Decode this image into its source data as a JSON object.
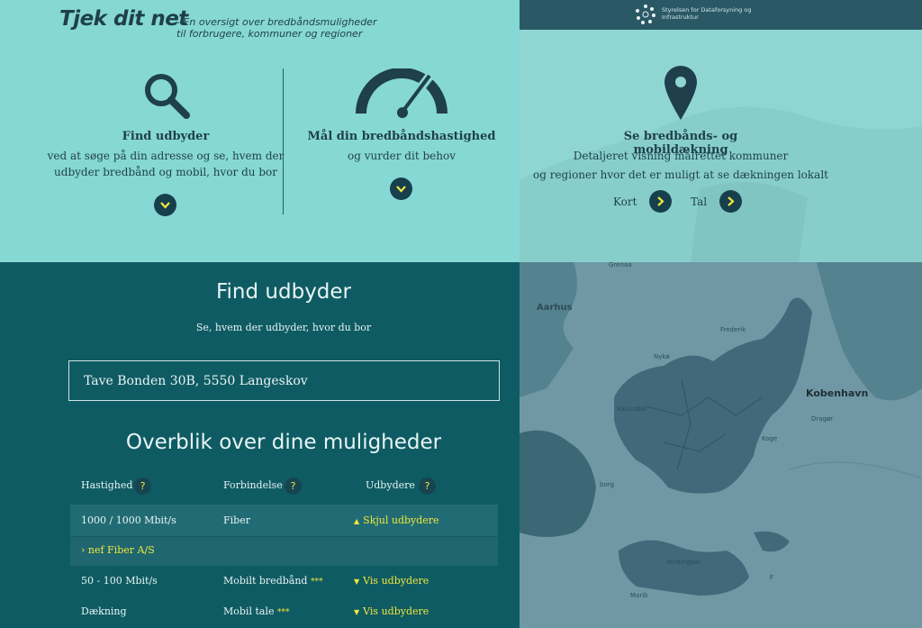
{
  "brand": {
    "logo": "Tjek dit net",
    "tagline": "- En oversigt over bredbåndsmuligheder til forbrugere, kommuner og regioner",
    "agency": "Styrelsen for Dataforsyning og Infrastruktur"
  },
  "features": {
    "find": {
      "title": "Find udbyder",
      "line1": "ved at søge på din adresse og se, hvem der",
      "line2": "udbyder bredbånd og mobil, hvor du bor"
    },
    "speed": {
      "title": "Mål din bredbåndshastighed",
      "sub": "og vurder dit behov"
    },
    "coverage": {
      "title": "Se bredbånds- og mobildækning",
      "line1": "Detaljeret visning målrettet kommuner",
      "line2": "og regioner hvor det er muligt at se dækningen lokalt",
      "kort": "Kort",
      "tal": "Tal"
    }
  },
  "finder": {
    "title": "Find udbyder",
    "subtitle": "Se, hvem der udbyder, hvor du bor",
    "address": "Tave Bonden 30B, 5550 Langeskov"
  },
  "overview": {
    "title": "Overblik over dine muligheder",
    "headers": {
      "speed": "Hastighed",
      "connection": "Forbindelse",
      "providers": "Udbydere"
    },
    "help": "?",
    "rows": [
      {
        "speed": "1000 / 1000 Mbit/s",
        "connection": "Fiber",
        "stars": "",
        "action": "Skjul udbydere"
      },
      {
        "speed": "50 - 100 Mbit/s",
        "connection": "Mobilt bredbånd",
        "stars": "***",
        "action": "Vis udbydere"
      },
      {
        "speed": "Dækning",
        "connection": "Mobil tale",
        "stars": "***",
        "action": "Vis udbydere"
      }
    ],
    "provider": "› nef Fiber A/S"
  },
  "map": {
    "labels": [
      "Grenaa",
      "Aarhus",
      "Frederik",
      "Nykø",
      "Kalundbo",
      "Kobenhavn",
      "Dragør",
      "Koge",
      "Vordingbor",
      "Marib",
      "F",
      "borg"
    ]
  },
  "colors": {
    "accent": "#f1e63a",
    "dark": "#0f5b63",
    "light": "#86d8d4"
  }
}
